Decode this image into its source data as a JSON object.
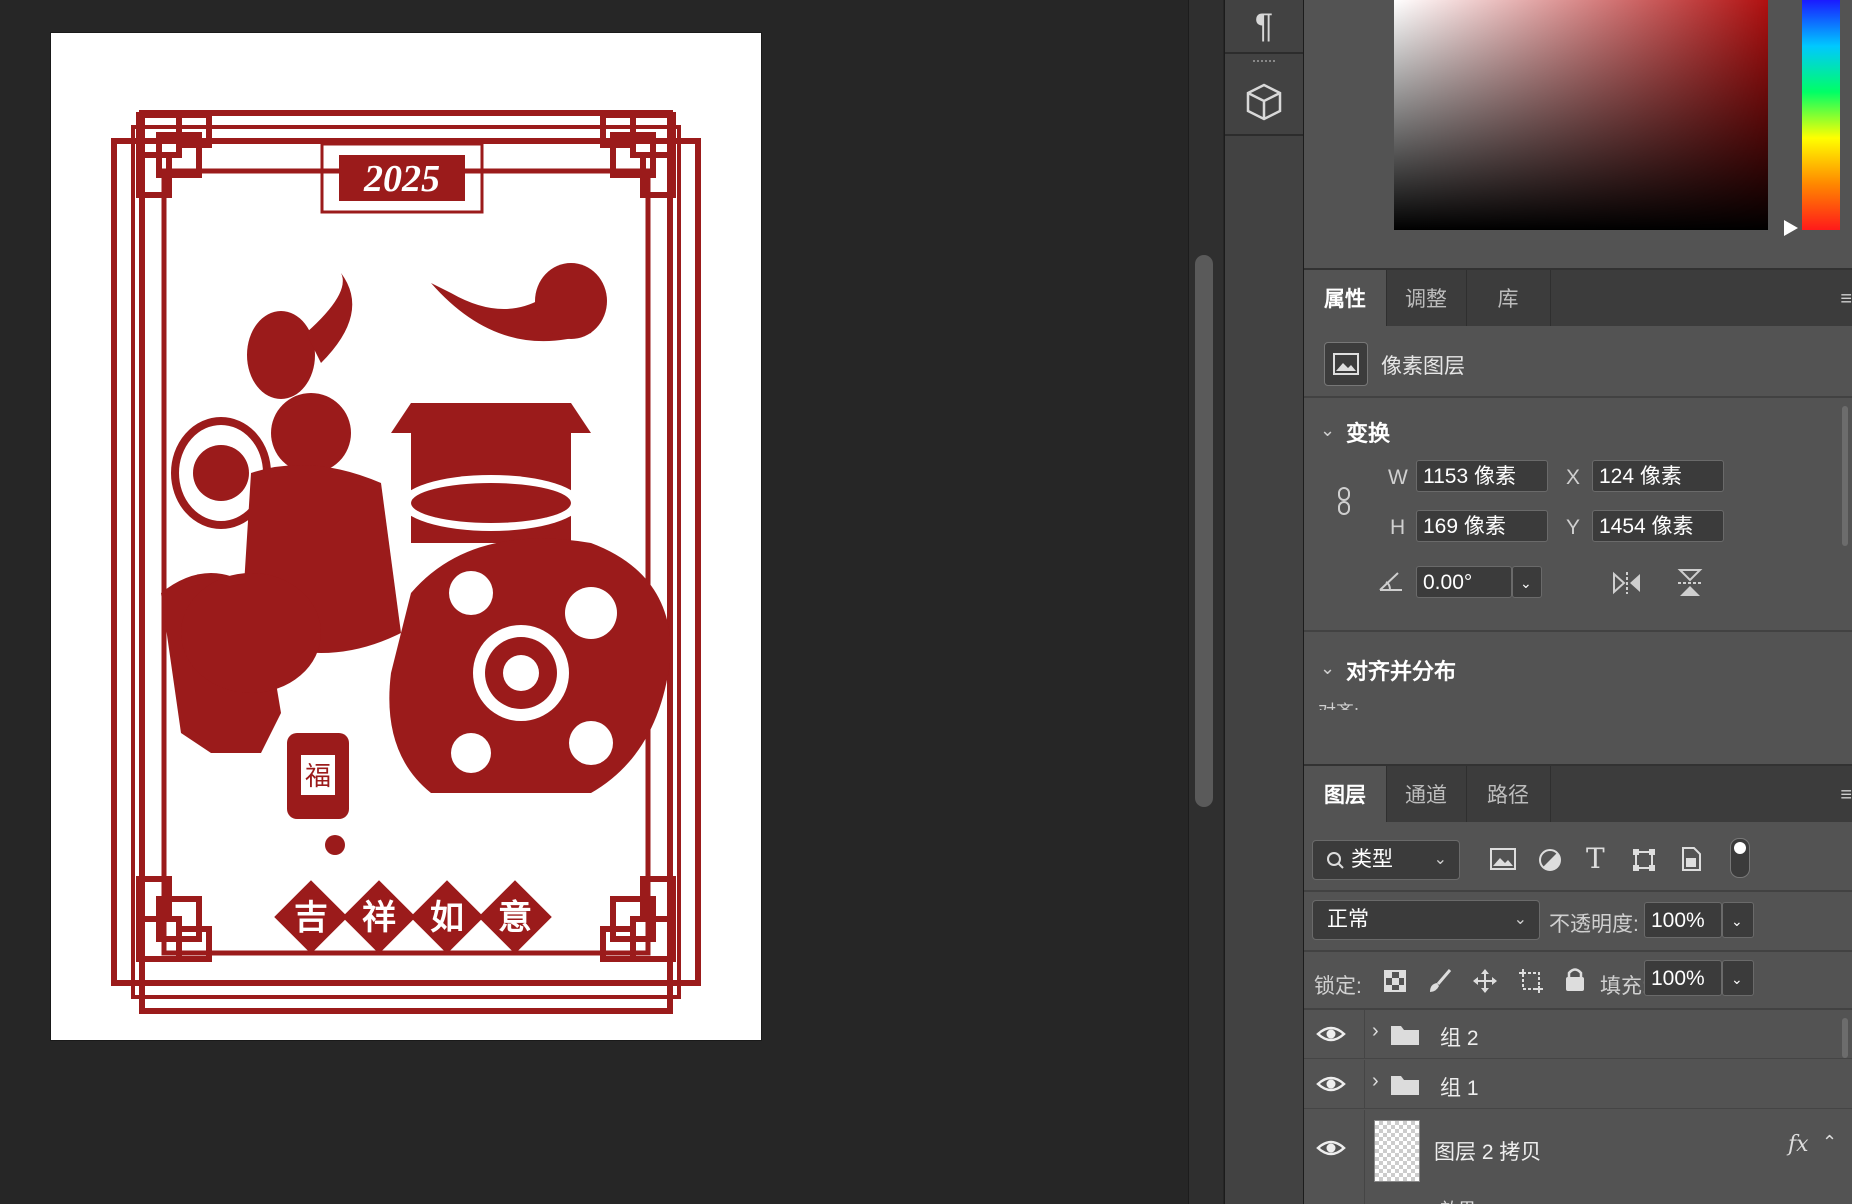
{
  "canvas": {
    "year_label": "2025",
    "blessing_chars": [
      "吉",
      "祥",
      "如",
      "意"
    ],
    "lantern_char": "福",
    "art_color": "#9b1b1b"
  },
  "properties_panel": {
    "tabs": [
      {
        "label": "属性",
        "active": true
      },
      {
        "label": "调整",
        "active": false
      },
      {
        "label": "库",
        "active": false
      }
    ],
    "layer_type": "像素图层",
    "transform": {
      "title": "变换",
      "w_label": "W",
      "w_value": "1153 像素",
      "h_label": "H",
      "h_value": "169 像素",
      "x_label": "X",
      "x_value": "124 像素",
      "y_label": "Y",
      "y_value": "1454 像素",
      "angle_value": "0.00°"
    },
    "align": {
      "title": "对齐并分布",
      "sub_label": "对齐:"
    }
  },
  "layers_panel": {
    "tabs": [
      {
        "label": "图层",
        "active": true
      },
      {
        "label": "通道",
        "active": false
      },
      {
        "label": "路径",
        "active": false
      }
    ],
    "filter_label": "类型",
    "blend_mode": "正常",
    "opacity_label": "不透明度:",
    "opacity_value": "100%",
    "lock_label": "锁定:",
    "fill_label": "填充:",
    "fill_value": "100%",
    "layers": [
      {
        "name": "组 2",
        "type": "group"
      },
      {
        "name": "组 1",
        "type": "group"
      },
      {
        "name": "图层 2 拷贝",
        "type": "pixel",
        "fx": "fx"
      }
    ],
    "partial_effect_label": "效果"
  }
}
